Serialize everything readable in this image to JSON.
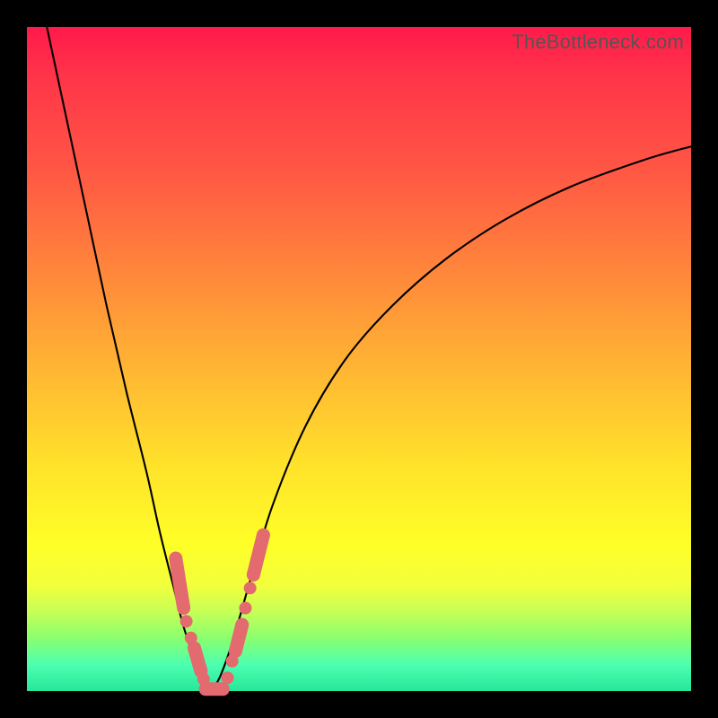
{
  "watermark": "TheBottleneck.com",
  "colors": {
    "frame": "#000000",
    "curve": "#000000",
    "marker": "#e36a6f"
  },
  "chart_data": {
    "type": "line",
    "title": "",
    "xlabel": "",
    "ylabel": "",
    "xlim": [
      0,
      100
    ],
    "ylim": [
      0,
      100
    ],
    "annotations": [
      "TheBottleneck.com"
    ],
    "series": [
      {
        "name": "left-branch",
        "x": [
          3,
          6,
          9,
          12,
          15,
          18,
          20,
          22,
          23.5,
          25,
          26,
          27,
          27.8
        ],
        "y": [
          100,
          86,
          72,
          58,
          45,
          33,
          24,
          16,
          10,
          5.5,
          3,
          1.2,
          0
        ]
      },
      {
        "name": "right-branch",
        "x": [
          27.8,
          29,
          30.5,
          32,
          34,
          37,
          42,
          48,
          55,
          63,
          72,
          82,
          93,
          100
        ],
        "y": [
          0,
          2,
          6,
          11,
          18,
          28,
          40,
          50,
          58,
          65,
          71,
          76,
          80,
          82
        ]
      }
    ],
    "markers": [
      {
        "shape": "capsule",
        "branch": "left",
        "x0": 22.4,
        "y0": 20.0,
        "x1": 23.6,
        "y1": 12.5
      },
      {
        "shape": "dot",
        "branch": "left",
        "x": 24.0,
        "y": 10.5
      },
      {
        "shape": "dot",
        "branch": "left",
        "x": 24.7,
        "y": 8.0
      },
      {
        "shape": "capsule",
        "branch": "left",
        "x0": 25.2,
        "y0": 6.5,
        "x1": 26.2,
        "y1": 3.0
      },
      {
        "shape": "dot",
        "branch": "left",
        "x": 26.6,
        "y": 1.8
      },
      {
        "shape": "capsule",
        "branch": "flat",
        "x0": 26.9,
        "y0": 0.3,
        "x1": 29.5,
        "y1": 0.3
      },
      {
        "shape": "dot",
        "branch": "right",
        "x": 30.2,
        "y": 2.0
      },
      {
        "shape": "dot",
        "branch": "right",
        "x": 30.9,
        "y": 4.5
      },
      {
        "shape": "capsule",
        "branch": "right",
        "x0": 31.4,
        "y0": 6.0,
        "x1": 32.4,
        "y1": 10.0
      },
      {
        "shape": "dot",
        "branch": "right",
        "x": 32.9,
        "y": 12.5
      },
      {
        "shape": "dot",
        "branch": "right",
        "x": 33.6,
        "y": 15.5
      },
      {
        "shape": "capsule",
        "branch": "right",
        "x0": 34.1,
        "y0": 17.5,
        "x1": 35.6,
        "y1": 23.5
      }
    ]
  }
}
